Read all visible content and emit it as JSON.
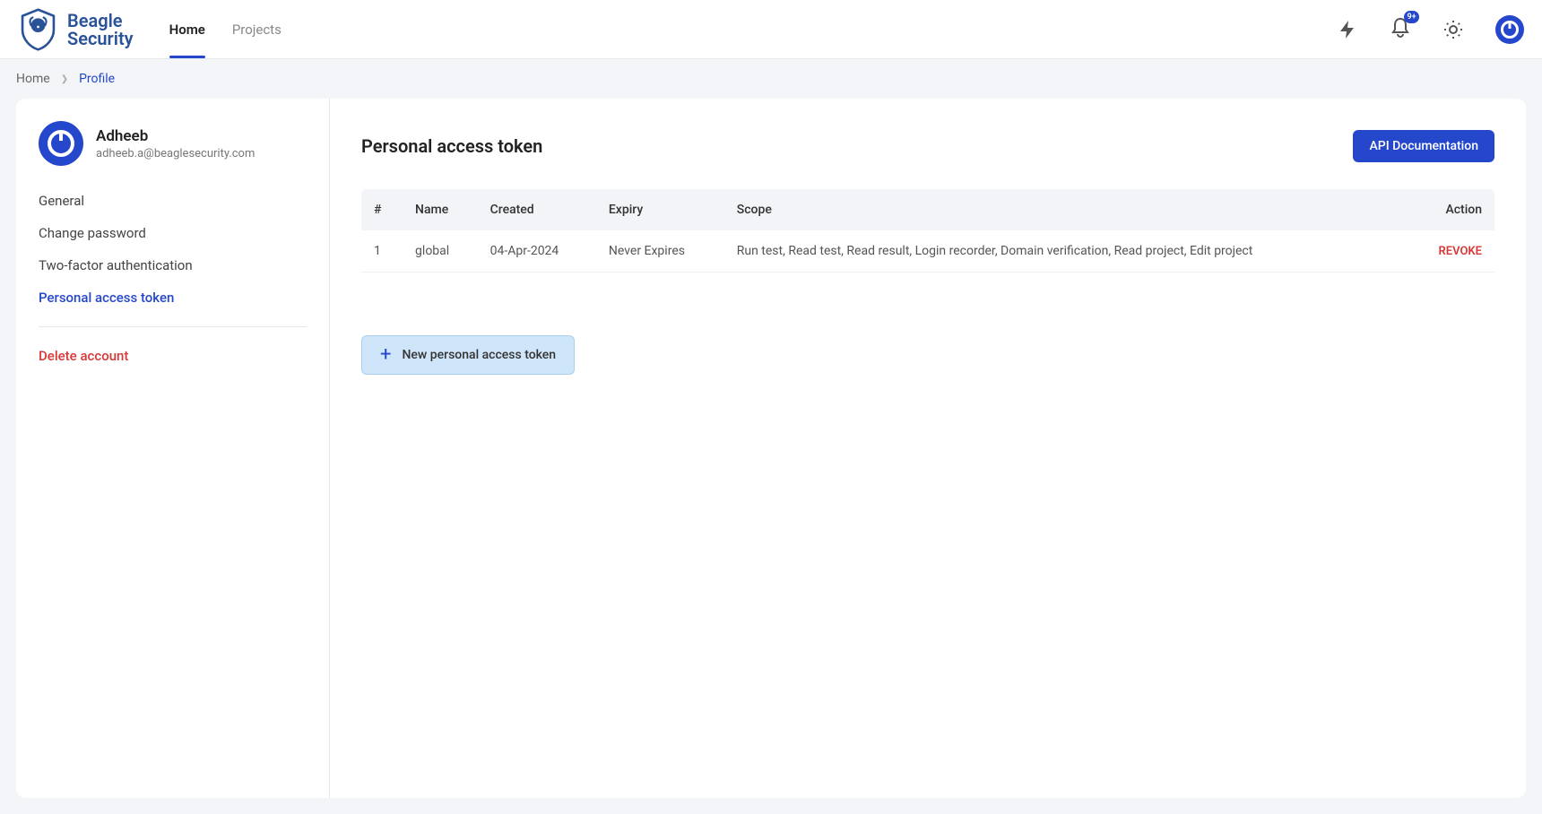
{
  "header": {
    "brand_line1": "Beagle",
    "brand_line2": "Security",
    "nav": [
      "Home",
      "Projects"
    ],
    "active_nav": 0,
    "notif_badge": "9+"
  },
  "breadcrumb": {
    "items": [
      "Home",
      "Profile"
    ]
  },
  "user": {
    "name": "Adheeb",
    "email": "adheeb.a@beaglesecurity.com"
  },
  "sidebar": {
    "items": [
      "General",
      "Change password",
      "Two-factor authentication",
      "Personal access token"
    ],
    "active_index": 3,
    "delete": "Delete account"
  },
  "main": {
    "title": "Personal access token",
    "api_doc_btn": "API Documentation",
    "new_token_btn": "New personal access token",
    "table": {
      "headers": [
        "#",
        "Name",
        "Created",
        "Expiry",
        "Scope",
        "Action"
      ],
      "rows": [
        {
          "num": "1",
          "name": "global",
          "created": "04-Apr-2024",
          "expiry": "Never Expires",
          "scope": "Run test, Read test, Read result, Login recorder, Domain verification, Read project, Edit project",
          "action": "REVOKE"
        }
      ]
    }
  }
}
